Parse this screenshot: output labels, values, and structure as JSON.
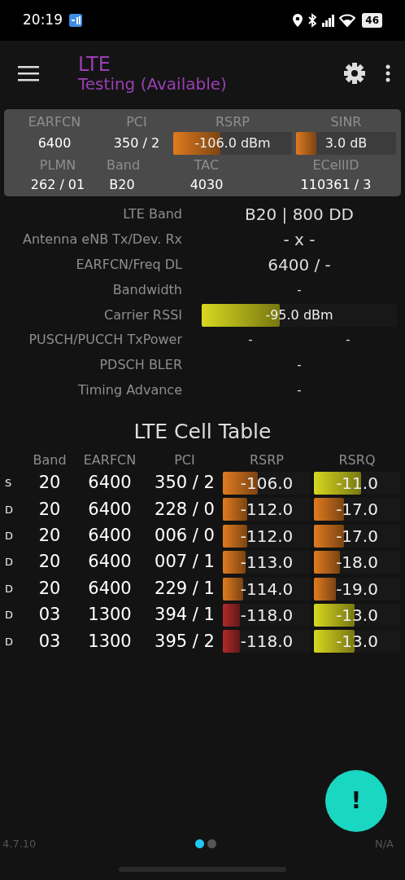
{
  "status_bar": {
    "time": "20:19",
    "battery": "46"
  },
  "app_bar": {
    "title": "LTE",
    "subtitle": "Testing (Available)"
  },
  "summary": {
    "top": [
      {
        "label": "EARFCN",
        "kind": "text",
        "value": "6400"
      },
      {
        "label": "PCI",
        "kind": "text",
        "value": "350 / 2"
      },
      {
        "label": "RSRP",
        "kind": "meter",
        "level": 0.4,
        "color": "#e07b20",
        "reading": "-106.0 dBm"
      },
      {
        "label": "SINR",
        "kind": "meter",
        "level": 0.2,
        "color": "#e07b20",
        "reading": "3.0 dB"
      }
    ],
    "bottom": [
      {
        "label": "PLMN",
        "value": "262 / 01"
      },
      {
        "label": "Band",
        "value": "B20"
      },
      {
        "label": "TAC",
        "value": "4030"
      },
      {
        "label": "ECellID",
        "value": "110361 / 3"
      }
    ]
  },
  "details": [
    {
      "label": "LTE Band",
      "kind": "big",
      "value": "B20 | 800 DD"
    },
    {
      "label": "Antenna eNB Tx/Dev. Rx",
      "kind": "big",
      "value": "- x -"
    },
    {
      "label": "EARFCN/Freq DL",
      "kind": "big",
      "value": "6400 / -"
    },
    {
      "label": "Bandwidth",
      "kind": "text",
      "value": "-"
    },
    {
      "label": "Carrier RSSI",
      "kind": "meter",
      "level": 0.4,
      "color": "#d8d820",
      "reading": "-95.0 dBm"
    },
    {
      "label": "PUSCH/PUCCH TxPower",
      "kind": "pair",
      "values": [
        "-",
        "-"
      ]
    },
    {
      "label": "PDSCH BLER",
      "kind": "text",
      "value": "-"
    },
    {
      "label": "Timing Advance",
      "kind": "text",
      "value": "-"
    }
  ],
  "cell_table": {
    "title": "LTE Cell Table",
    "columns": [
      "Band",
      "EARFCN",
      "PCI",
      "RSRP",
      "RSRQ"
    ],
    "rows": [
      {
        "type": "S",
        "band": "20",
        "earfcn": "6400",
        "pci": "350 / 2",
        "rsrp": {
          "reading": "-106.0",
          "level": 0.4,
          "color": "#e07b20"
        },
        "rsrq": {
          "reading": "-11.0",
          "level": 0.55,
          "color": "#d8d820"
        }
      },
      {
        "type": "D",
        "band": "20",
        "earfcn": "6400",
        "pci": "228 / 0",
        "rsrp": {
          "reading": "-112.0",
          "level": 0.28,
          "color": "#e07b20"
        },
        "rsrq": {
          "reading": "-17.0",
          "level": 0.35,
          "color": "#e07b20"
        }
      },
      {
        "type": "D",
        "band": "20",
        "earfcn": "6400",
        "pci": "006 / 0",
        "rsrp": {
          "reading": "-112.0",
          "level": 0.28,
          "color": "#e07b20"
        },
        "rsrq": {
          "reading": "-17.0",
          "level": 0.35,
          "color": "#e07b20"
        }
      },
      {
        "type": "D",
        "band": "20",
        "earfcn": "6400",
        "pci": "007 / 1",
        "rsrp": {
          "reading": "-113.0",
          "level": 0.26,
          "color": "#e07b20"
        },
        "rsrq": {
          "reading": "-18.0",
          "level": 0.3,
          "color": "#e07b20"
        }
      },
      {
        "type": "D",
        "band": "20",
        "earfcn": "6400",
        "pci": "229 / 1",
        "rsrp": {
          "reading": "-114.0",
          "level": 0.23,
          "color": "#e07b20"
        },
        "rsrq": {
          "reading": "-19.0",
          "level": 0.25,
          "color": "#e07b20"
        }
      },
      {
        "type": "D",
        "band": "03",
        "earfcn": "1300",
        "pci": "394 / 1",
        "rsrp": {
          "reading": "-118.0",
          "level": 0.19,
          "color": "#b02a2a"
        },
        "rsrq": {
          "reading": "-13.0",
          "level": 0.47,
          "color": "#d8d820"
        }
      },
      {
        "type": "D",
        "band": "03",
        "earfcn": "1300",
        "pci": "395 / 2",
        "rsrp": {
          "reading": "-118.0",
          "level": 0.19,
          "color": "#b02a2a"
        },
        "rsrq": {
          "reading": "-13.0",
          "level": 0.47,
          "color": "#d8d820"
        }
      }
    ]
  },
  "fab": {
    "label": "!"
  },
  "footer": {
    "version": "4.7.10",
    "right": "N/A",
    "pages": [
      {
        "selected": true
      },
      {
        "selected": false
      }
    ]
  }
}
